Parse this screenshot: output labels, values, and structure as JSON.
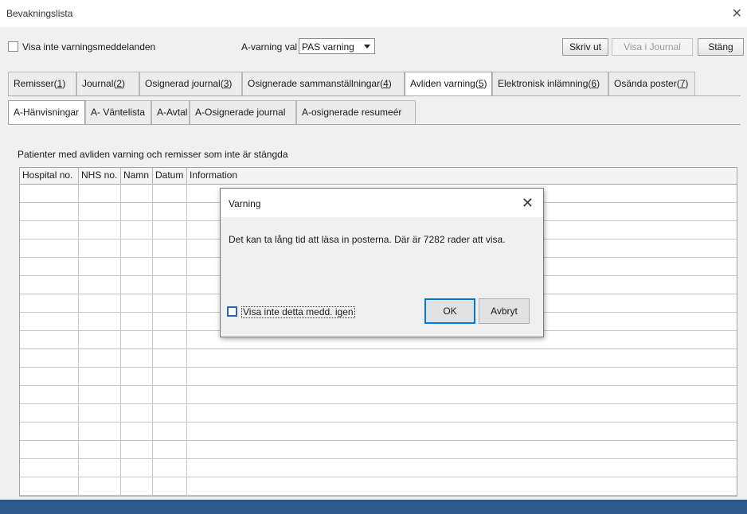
{
  "window": {
    "title": "Bevakningslista",
    "close_glyph": "✕"
  },
  "toolbar": {
    "hide_warnings_label": "Visa inte varningsmeddelanden",
    "a_warning_choice_label": "A-varning val",
    "a_warning_selected": "PAS varning",
    "print_label": "Skriv ut",
    "show_in_journal_label": "Visa i Journal",
    "close_label": "Stäng"
  },
  "tabs": [
    {
      "pre": "Remisser(",
      "key": "1",
      "post": ")",
      "active": false
    },
    {
      "pre": "Journal(",
      "key": "2",
      "post": ")",
      "active": false
    },
    {
      "pre": "Osignerad journal(",
      "key": "3",
      "post": ")",
      "active": false
    },
    {
      "pre": "Osignerade sammanställningar(",
      "key": "4",
      "post": ")",
      "active": false
    },
    {
      "pre": "Avliden varning(",
      "key": "5",
      "post": ")",
      "active": true
    },
    {
      "pre": "Elektronisk inlämning(",
      "key": "6",
      "post": ")",
      "active": false
    },
    {
      "pre": "Osända poster(",
      "key": "7",
      "post": ")",
      "active": false
    }
  ],
  "subtabs": [
    {
      "label": "A-Hänvisningar",
      "active": true
    },
    {
      "label": "A- Väntelista",
      "active": false
    },
    {
      "label": "A-Avtal",
      "active": false
    },
    {
      "label": "A-Osignerade journal",
      "active": false
    },
    {
      "label": "A-osignerade resumeér",
      "active": false
    }
  ],
  "panel": {
    "caption": "Patienter med avliden varning och remisser som inte är stängda"
  },
  "table": {
    "columns": [
      "Hospital no.",
      "NHS no.",
      "Namn",
      "Datum",
      "Information"
    ],
    "rows": []
  },
  "dialog": {
    "title": "Varning",
    "close_glyph": "✕",
    "message": "Det kan ta lång tid att läsa in posterna. Där är 7282 rader att visa.",
    "dont_show_again_label": "Visa inte detta medd. igen",
    "ok_label": "OK",
    "cancel_label": "Avbryt"
  },
  "colors": {
    "accent": "#0078d7",
    "status_bar": "#2d5a8c"
  },
  "icons": {
    "window_close": "close-icon",
    "dialog_close": "close-icon",
    "dropdown": "chevron-down-icon"
  }
}
